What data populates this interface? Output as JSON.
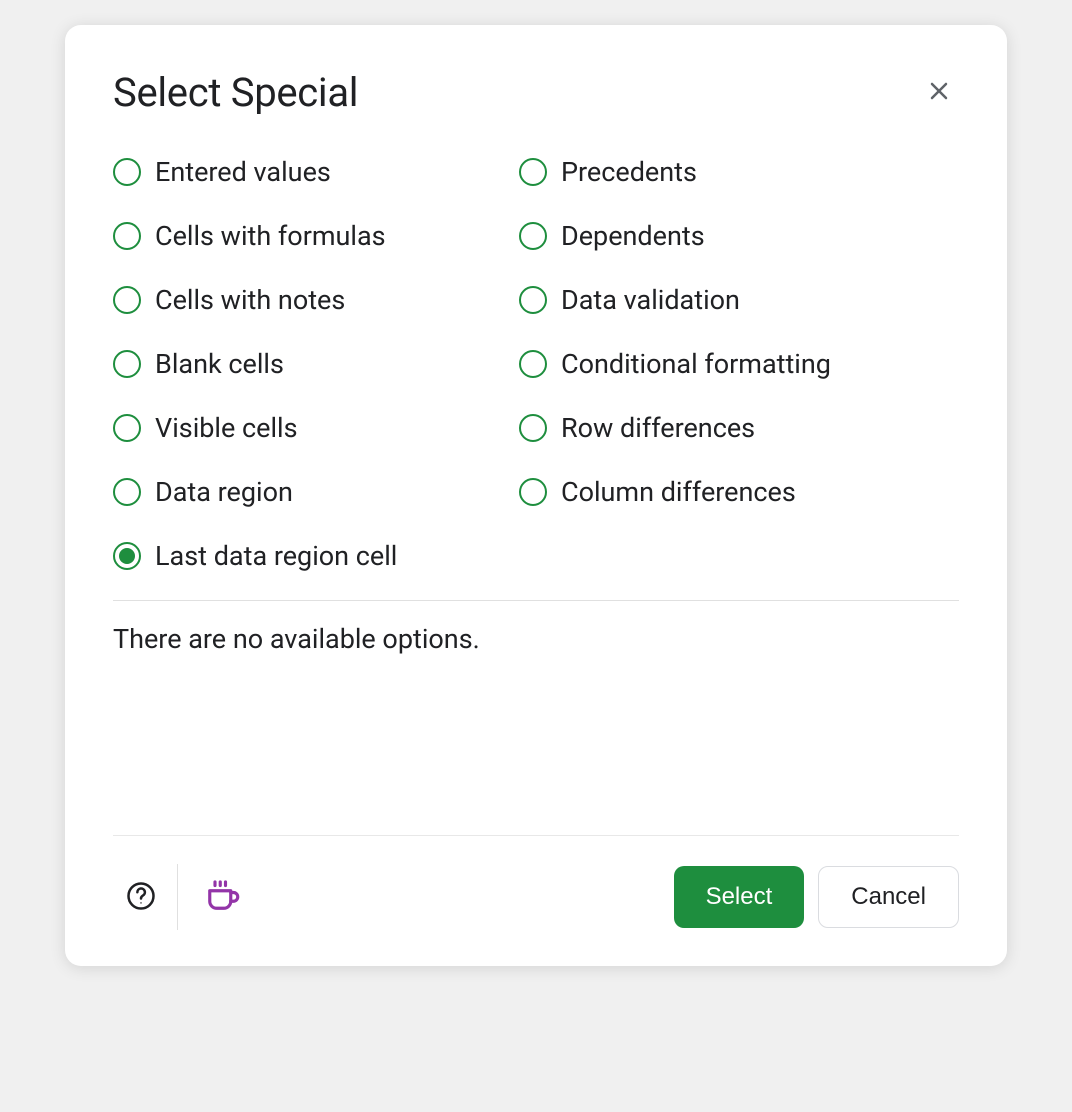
{
  "dialog": {
    "title": "Select Special",
    "radios": {
      "col1": [
        {
          "label": "Entered values",
          "checked": false,
          "name": "radio-entered-values"
        },
        {
          "label": "Cells with formulas",
          "checked": false,
          "name": "radio-cells-formulas"
        },
        {
          "label": "Cells with notes",
          "checked": false,
          "name": "radio-cells-notes"
        },
        {
          "label": "Blank cells",
          "checked": false,
          "name": "radio-blank-cells"
        },
        {
          "label": "Visible cells",
          "checked": false,
          "name": "radio-visible-cells"
        },
        {
          "label": "Data region",
          "checked": false,
          "name": "radio-data-region"
        },
        {
          "label": "Last data region cell",
          "checked": true,
          "name": "radio-last-data-region-cell"
        }
      ],
      "col2": [
        {
          "label": "Precedents",
          "checked": false,
          "name": "radio-precedents"
        },
        {
          "label": "Dependents",
          "checked": false,
          "name": "radio-dependents"
        },
        {
          "label": "Data validation",
          "checked": false,
          "name": "radio-data-validation"
        },
        {
          "label": "Conditional formatting",
          "checked": false,
          "name": "radio-conditional-formatting"
        },
        {
          "label": "Row differences",
          "checked": false,
          "name": "radio-row-differences"
        },
        {
          "label": "Column differences",
          "checked": false,
          "name": "radio-column-differences"
        }
      ]
    },
    "info_text": "There are no available options.",
    "buttons": {
      "select": "Select",
      "cancel": "Cancel"
    }
  }
}
